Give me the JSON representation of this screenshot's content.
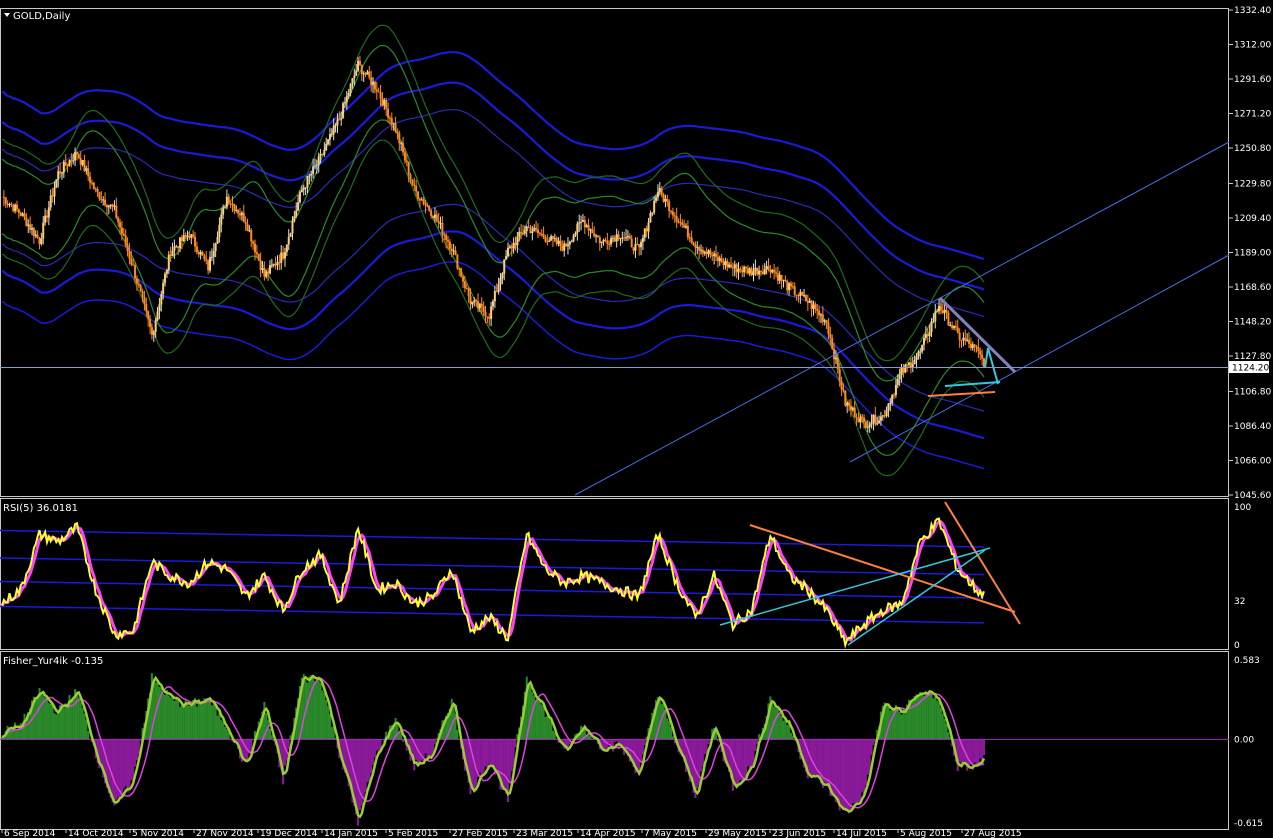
{
  "chart_data": [
    {
      "type": "candlestick",
      "title": "GOLD,Daily",
      "ylim": [
        1045.6,
        1332.4
      ],
      "y_ticks": [
        "1332.40",
        "1312.00",
        "1291.60",
        "1271.20",
        "1250.80",
        "1229.80",
        "1209.40",
        "1189.00",
        "1168.60",
        "1148.20",
        "1127.80",
        "1106.80",
        "1086.40",
        "1066.00",
        "1045.60"
      ],
      "current_price": "1124.20",
      "x_labels": [
        "6 Sep 2014",
        "14 Oct 2014",
        "5 Nov 2014",
        "27 Nov 2014",
        "19 Dec 2014",
        "14 Jan 2015",
        "5 Feb 2015",
        "27 Feb 2015",
        "23 Mar 2015",
        "14 Apr 2015",
        "7 May 2015",
        "29 May 2015",
        "23 Jun 2015",
        "14 Jul 2015",
        "5 Aug 2015",
        "27 Aug 2015"
      ],
      "close_anchors": [
        [
          0,
          1222
        ],
        [
          10,
          1212
        ],
        [
          20,
          1196
        ],
        [
          30,
          1236
        ],
        [
          40,
          1248
        ],
        [
          50,
          1225
        ],
        [
          60,
          1214
        ],
        [
          70,
          1180
        ],
        [
          80,
          1140
        ],
        [
          90,
          1190
        ],
        [
          100,
          1200
        ],
        [
          110,
          1180
        ],
        [
          120,
          1222
        ],
        [
          130,
          1208
        ],
        [
          140,
          1175
        ],
        [
          150,
          1188
        ],
        [
          160,
          1226
        ],
        [
          170,
          1245
        ],
        [
          180,
          1268
        ],
        [
          190,
          1300
        ],
        [
          200,
          1286
        ],
        [
          210,
          1262
        ],
        [
          220,
          1226
        ],
        [
          230,
          1212
        ],
        [
          240,
          1192
        ],
        [
          250,
          1160
        ],
        [
          260,
          1152
        ],
        [
          270,
          1190
        ],
        [
          280,
          1204
        ],
        [
          290,
          1198
        ],
        [
          300,
          1192
        ],
        [
          310,
          1208
        ],
        [
          320,
          1195
        ],
        [
          330,
          1200
        ],
        [
          340,
          1190
        ],
        [
          350,
          1226
        ],
        [
          360,
          1210
        ],
        [
          370,
          1194
        ],
        [
          380,
          1186
        ],
        [
          390,
          1180
        ],
        [
          400,
          1178
        ],
        [
          410,
          1180
        ],
        [
          420,
          1168
        ],
        [
          430,
          1160
        ],
        [
          440,
          1148
        ],
        [
          450,
          1100
        ],
        [
          460,
          1088
        ],
        [
          470,
          1092
        ],
        [
          480,
          1118
        ],
        [
          490,
          1130
        ],
        [
          500,
          1158
        ],
        [
          510,
          1140
        ],
        [
          520,
          1131
        ],
        [
          524,
          1124
        ]
      ]
    },
    {
      "type": "line",
      "title": "RSI(5) 36.0181",
      "ylim": [
        0,
        100
      ],
      "y_ticks": [
        "100",
        "32",
        "0"
      ],
      "anchors": [
        [
          0,
          30
        ],
        [
          10,
          40
        ],
        [
          20,
          80
        ],
        [
          30,
          75
        ],
        [
          40,
          85
        ],
        [
          50,
          40
        ],
        [
          60,
          8
        ],
        [
          70,
          10
        ],
        [
          80,
          60
        ],
        [
          90,
          50
        ],
        [
          100,
          45
        ],
        [
          110,
          60
        ],
        [
          120,
          55
        ],
        [
          130,
          35
        ],
        [
          140,
          50
        ],
        [
          150,
          25
        ],
        [
          160,
          55
        ],
        [
          170,
          65
        ],
        [
          180,
          30
        ],
        [
          190,
          85
        ],
        [
          200,
          40
        ],
        [
          210,
          45
        ],
        [
          220,
          30
        ],
        [
          230,
          35
        ],
        [
          240,
          55
        ],
        [
          250,
          10
        ],
        [
          260,
          20
        ],
        [
          270,
          5
        ],
        [
          280,
          80
        ],
        [
          290,
          55
        ],
        [
          300,
          45
        ],
        [
          310,
          50
        ],
        [
          320,
          45
        ],
        [
          330,
          40
        ],
        [
          340,
          35
        ],
        [
          350,
          80
        ],
        [
          360,
          45
        ],
        [
          370,
          20
        ],
        [
          380,
          50
        ],
        [
          390,
          15
        ],
        [
          400,
          25
        ],
        [
          410,
          80
        ],
        [
          420,
          50
        ],
        [
          430,
          40
        ],
        [
          440,
          25
        ],
        [
          450,
          2
        ],
        [
          460,
          15
        ],
        [
          470,
          25
        ],
        [
          480,
          30
        ],
        [
          490,
          75
        ],
        [
          500,
          90
        ],
        [
          510,
          55
        ],
        [
          520,
          40
        ],
        [
          524,
          36
        ]
      ]
    },
    {
      "type": "bar",
      "title": "Fisher_Yur4ik -0.135",
      "ylim": [
        -0.615,
        0.583
      ],
      "y_ticks": [
        "0.583",
        "0.00",
        "-0.615"
      ],
      "anchors": [
        [
          0,
          0.05
        ],
        [
          10,
          0.1
        ],
        [
          20,
          0.35
        ],
        [
          30,
          0.2
        ],
        [
          40,
          0.35
        ],
        [
          50,
          -0.1
        ],
        [
          60,
          -0.5
        ],
        [
          70,
          -0.3
        ],
        [
          80,
          0.45
        ],
        [
          90,
          0.3
        ],
        [
          100,
          0.25
        ],
        [
          110,
          0.3
        ],
        [
          120,
          0.1
        ],
        [
          130,
          -0.2
        ],
        [
          140,
          0.25
        ],
        [
          150,
          -0.3
        ],
        [
          160,
          0.45
        ],
        [
          170,
          0.45
        ],
        [
          180,
          -0.1
        ],
        [
          190,
          -0.6
        ],
        [
          200,
          -0.1
        ],
        [
          210,
          0.15
        ],
        [
          220,
          -0.2
        ],
        [
          230,
          -0.1
        ],
        [
          240,
          0.3
        ],
        [
          250,
          -0.4
        ],
        [
          260,
          -0.15
        ],
        [
          270,
          -0.45
        ],
        [
          280,
          0.45
        ],
        [
          290,
          0.2
        ],
        [
          300,
          -0.1
        ],
        [
          310,
          0.1
        ],
        [
          320,
          -0.05
        ],
        [
          330,
          -0.05
        ],
        [
          340,
          -0.25
        ],
        [
          350,
          0.35
        ],
        [
          360,
          -0.05
        ],
        [
          370,
          -0.4
        ],
        [
          380,
          0.1
        ],
        [
          390,
          -0.35
        ],
        [
          400,
          -0.2
        ],
        [
          410,
          0.3
        ],
        [
          420,
          0.1
        ],
        [
          430,
          -0.25
        ],
        [
          440,
          -0.35
        ],
        [
          450,
          -0.55
        ],
        [
          460,
          -0.4
        ],
        [
          470,
          0.25
        ],
        [
          480,
          0.2
        ],
        [
          490,
          0.35
        ],
        [
          500,
          0.3
        ],
        [
          510,
          -0.2
        ],
        [
          520,
          -0.2
        ],
        [
          524,
          -0.135
        ]
      ]
    }
  ]
}
